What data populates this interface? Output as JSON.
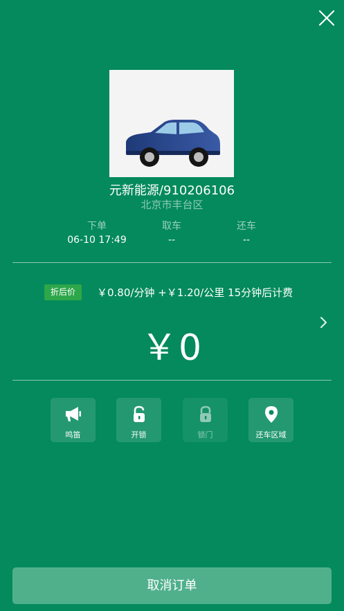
{
  "header": {
    "close_icon": "close-icon"
  },
  "car": {
    "name": "元新能源/910206106",
    "location": "北京市丰台区",
    "image": "blue-sedan-car",
    "colors": {
      "body": "#2b4a8c",
      "background": "#f4f4f4"
    }
  },
  "status": [
    {
      "label": "下单",
      "value": "06-10 17:49"
    },
    {
      "label": "取车",
      "value": "--"
    },
    {
      "label": "还车",
      "value": "--"
    }
  ],
  "pricing": {
    "tag": "折后价",
    "rate": "￥0.80/分钟 +￥1.20/公里",
    "free_note": "15分钟后计费",
    "amount": "￥0",
    "detail_icon": "chevron-right-icon"
  },
  "actions": [
    {
      "label": "鸣笛",
      "icon": "horn-icon",
      "enabled": true
    },
    {
      "label": "开锁",
      "icon": "unlock-icon",
      "enabled": true
    },
    {
      "label": "锁门",
      "icon": "lock-icon",
      "enabled": false
    },
    {
      "label": "还车区域",
      "icon": "location-pin-icon",
      "enabled": true
    }
  ],
  "footer": {
    "cancel_label": "取消订单"
  },
  "colors": {
    "background": "#048a5c",
    "tag": "#2ea64a",
    "cancel_button": "#51b08c"
  }
}
